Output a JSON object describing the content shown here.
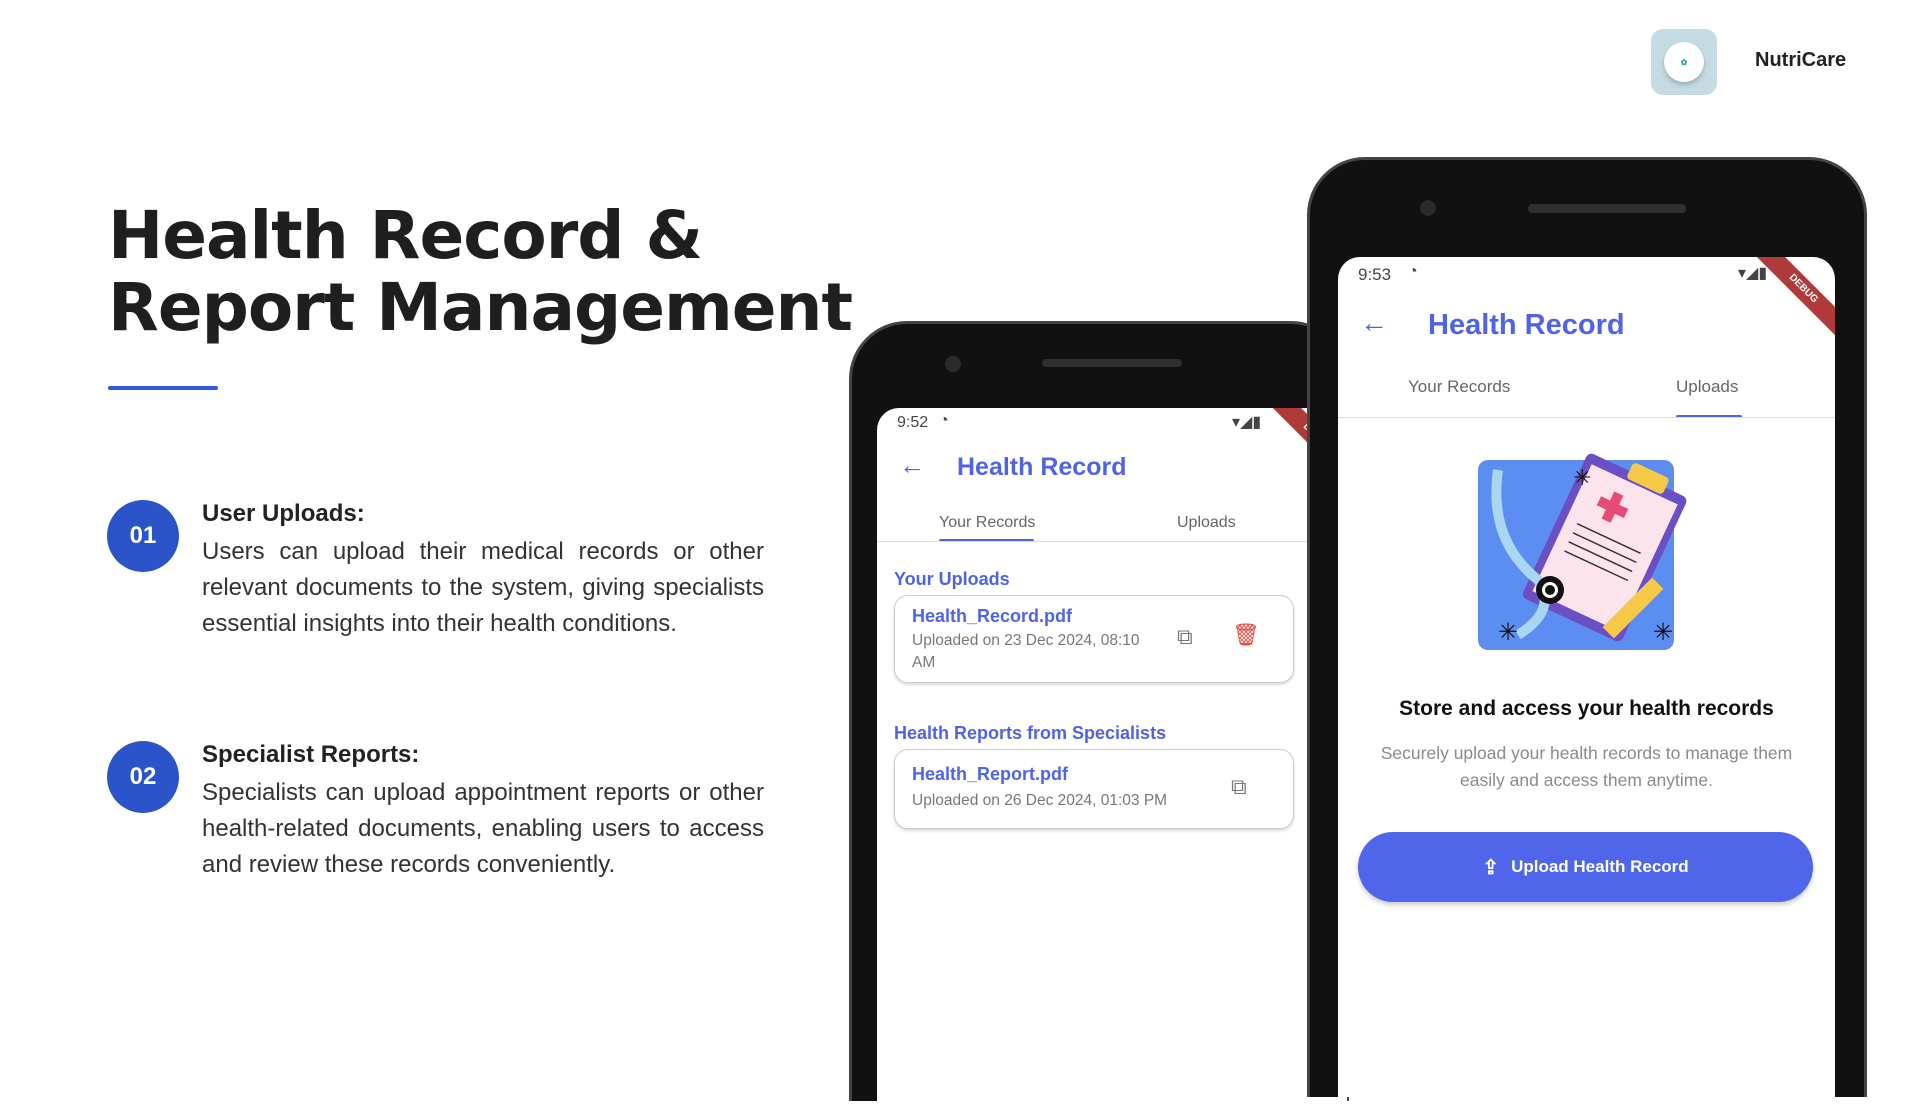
{
  "brand": {
    "name": "NutriCare",
    "logo_text": "NutriCare"
  },
  "heading": {
    "line1": "Health Record &",
    "line2": "Report Management"
  },
  "features": [
    {
      "num": "01",
      "title": "User Uploads:",
      "text": "Users can upload their medical records or other relevant documents to the system, giving specialists essential insights into their health conditions."
    },
    {
      "num": "02",
      "title": "Specialist Reports:",
      "text": "Specialists can upload appointment reports or other health-related documents, enabling users to access and review these records conveniently."
    }
  ],
  "phone1": {
    "time": "9:52",
    "debug": "DEBUG",
    "title": "Health Record",
    "tabs": [
      "Your Records",
      "Uploads"
    ],
    "active_tab": 0,
    "section1": "Your Uploads",
    "upload": {
      "name": "Health_Record.pdf",
      "date": "Uploaded on 23 Dec 2024, 08:10 AM"
    },
    "section2": "Health Reports from Specialists",
    "report": {
      "name": "Health_Report.pdf",
      "date": "Uploaded on 26 Dec 2024, 01:03 PM"
    }
  },
  "phone2": {
    "time": "9:53",
    "debug": "DEBUG",
    "title": "Health Record",
    "tabs": [
      "Your Records",
      "Uploads"
    ],
    "active_tab": 1,
    "empty_title": "Store and access your health records",
    "empty_desc": "Securely upload your health records to manage them easily and access them anytime.",
    "button": "Upload Health Record"
  },
  "colors": {
    "accent": "#4f63e7",
    "badge": "#2c54c9",
    "delete": "#f23b2f"
  }
}
